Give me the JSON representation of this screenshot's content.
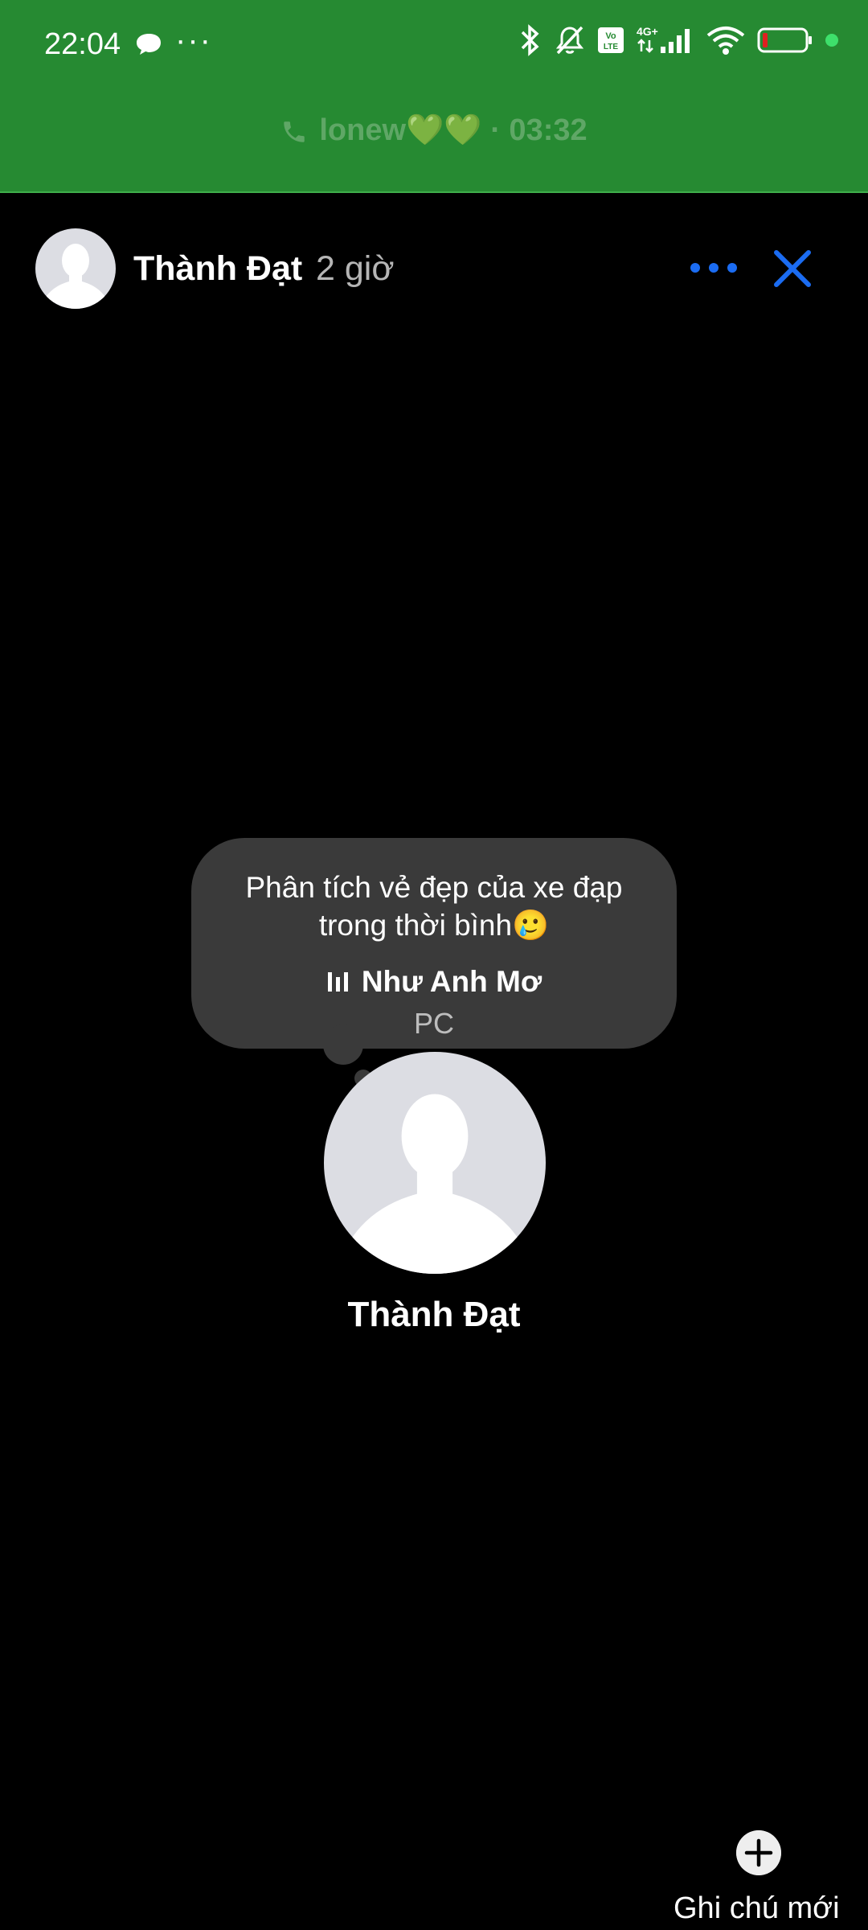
{
  "status_bar": {
    "time": "22:04",
    "more": "···",
    "network": "4G+",
    "volte": "Vo LTE"
  },
  "call_banner": {
    "text": "lonew💚💚 · 03:32"
  },
  "header": {
    "name": "Thành Đạt",
    "time_ago": "2 giờ"
  },
  "note": {
    "text_line1": "Phân tích vẻ đẹp của xe đạp",
    "text_line2": "trong thời bình🥲",
    "song": "Như Anh Mơ",
    "artist": "PC"
  },
  "profile": {
    "name": "Thành Đạt"
  },
  "new_note": {
    "label": "Ghi chú mới"
  },
  "colors": {
    "banner": "#268a32",
    "accent": "#1b6cf2",
    "bubble": "#3a3a3a"
  }
}
